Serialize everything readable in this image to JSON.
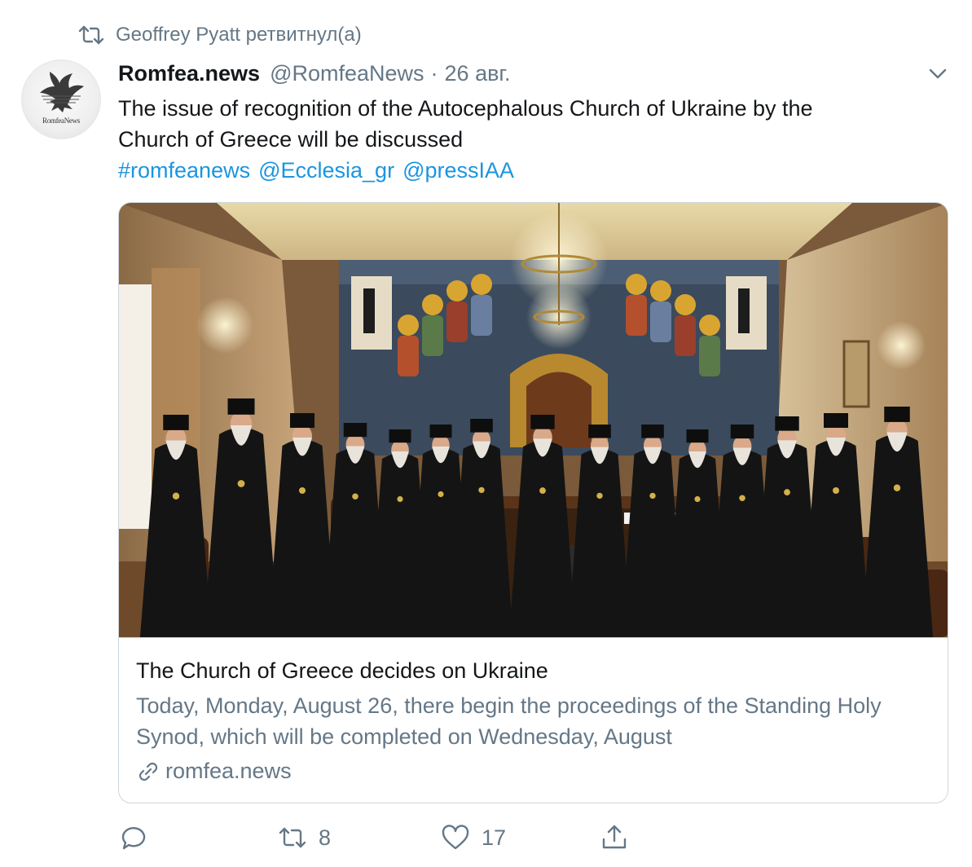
{
  "retweet": {
    "text": "Geoffrey Pyatt ретвитнул(а)",
    "icon": "retweet-icon"
  },
  "tweet": {
    "avatar_text": "RomfeaNews",
    "display_name": "Romfea.news",
    "handle": "@RomfeaNews",
    "separator": "·",
    "date": "26 авг.",
    "text_line1": "The issue of recognition of the Autocephalous Church of Ukraine by the",
    "text_line2": "Church of Greece will be discussed",
    "tags": [
      "#romfeanews",
      "@Ecclesia_gr",
      "@pressIAA"
    ]
  },
  "card": {
    "title": "The Church of Greece decides on Ukraine",
    "description": "Today, Monday, August 26, there begin the proceedings of the Standing Holy Synod, which will be completed on Wednesday, August",
    "domain": "romfea.news",
    "photo_alt": "Photo of the Holy Synod members in black robes standing around a conference table beneath a large icon fresco"
  },
  "actions": {
    "reply_count": "",
    "retweet_count": "8",
    "like_count": "17"
  },
  "colors": {
    "link": "#1b95e0",
    "secondary": "#657786",
    "border": "#ccd6dd",
    "text": "#14171a"
  }
}
